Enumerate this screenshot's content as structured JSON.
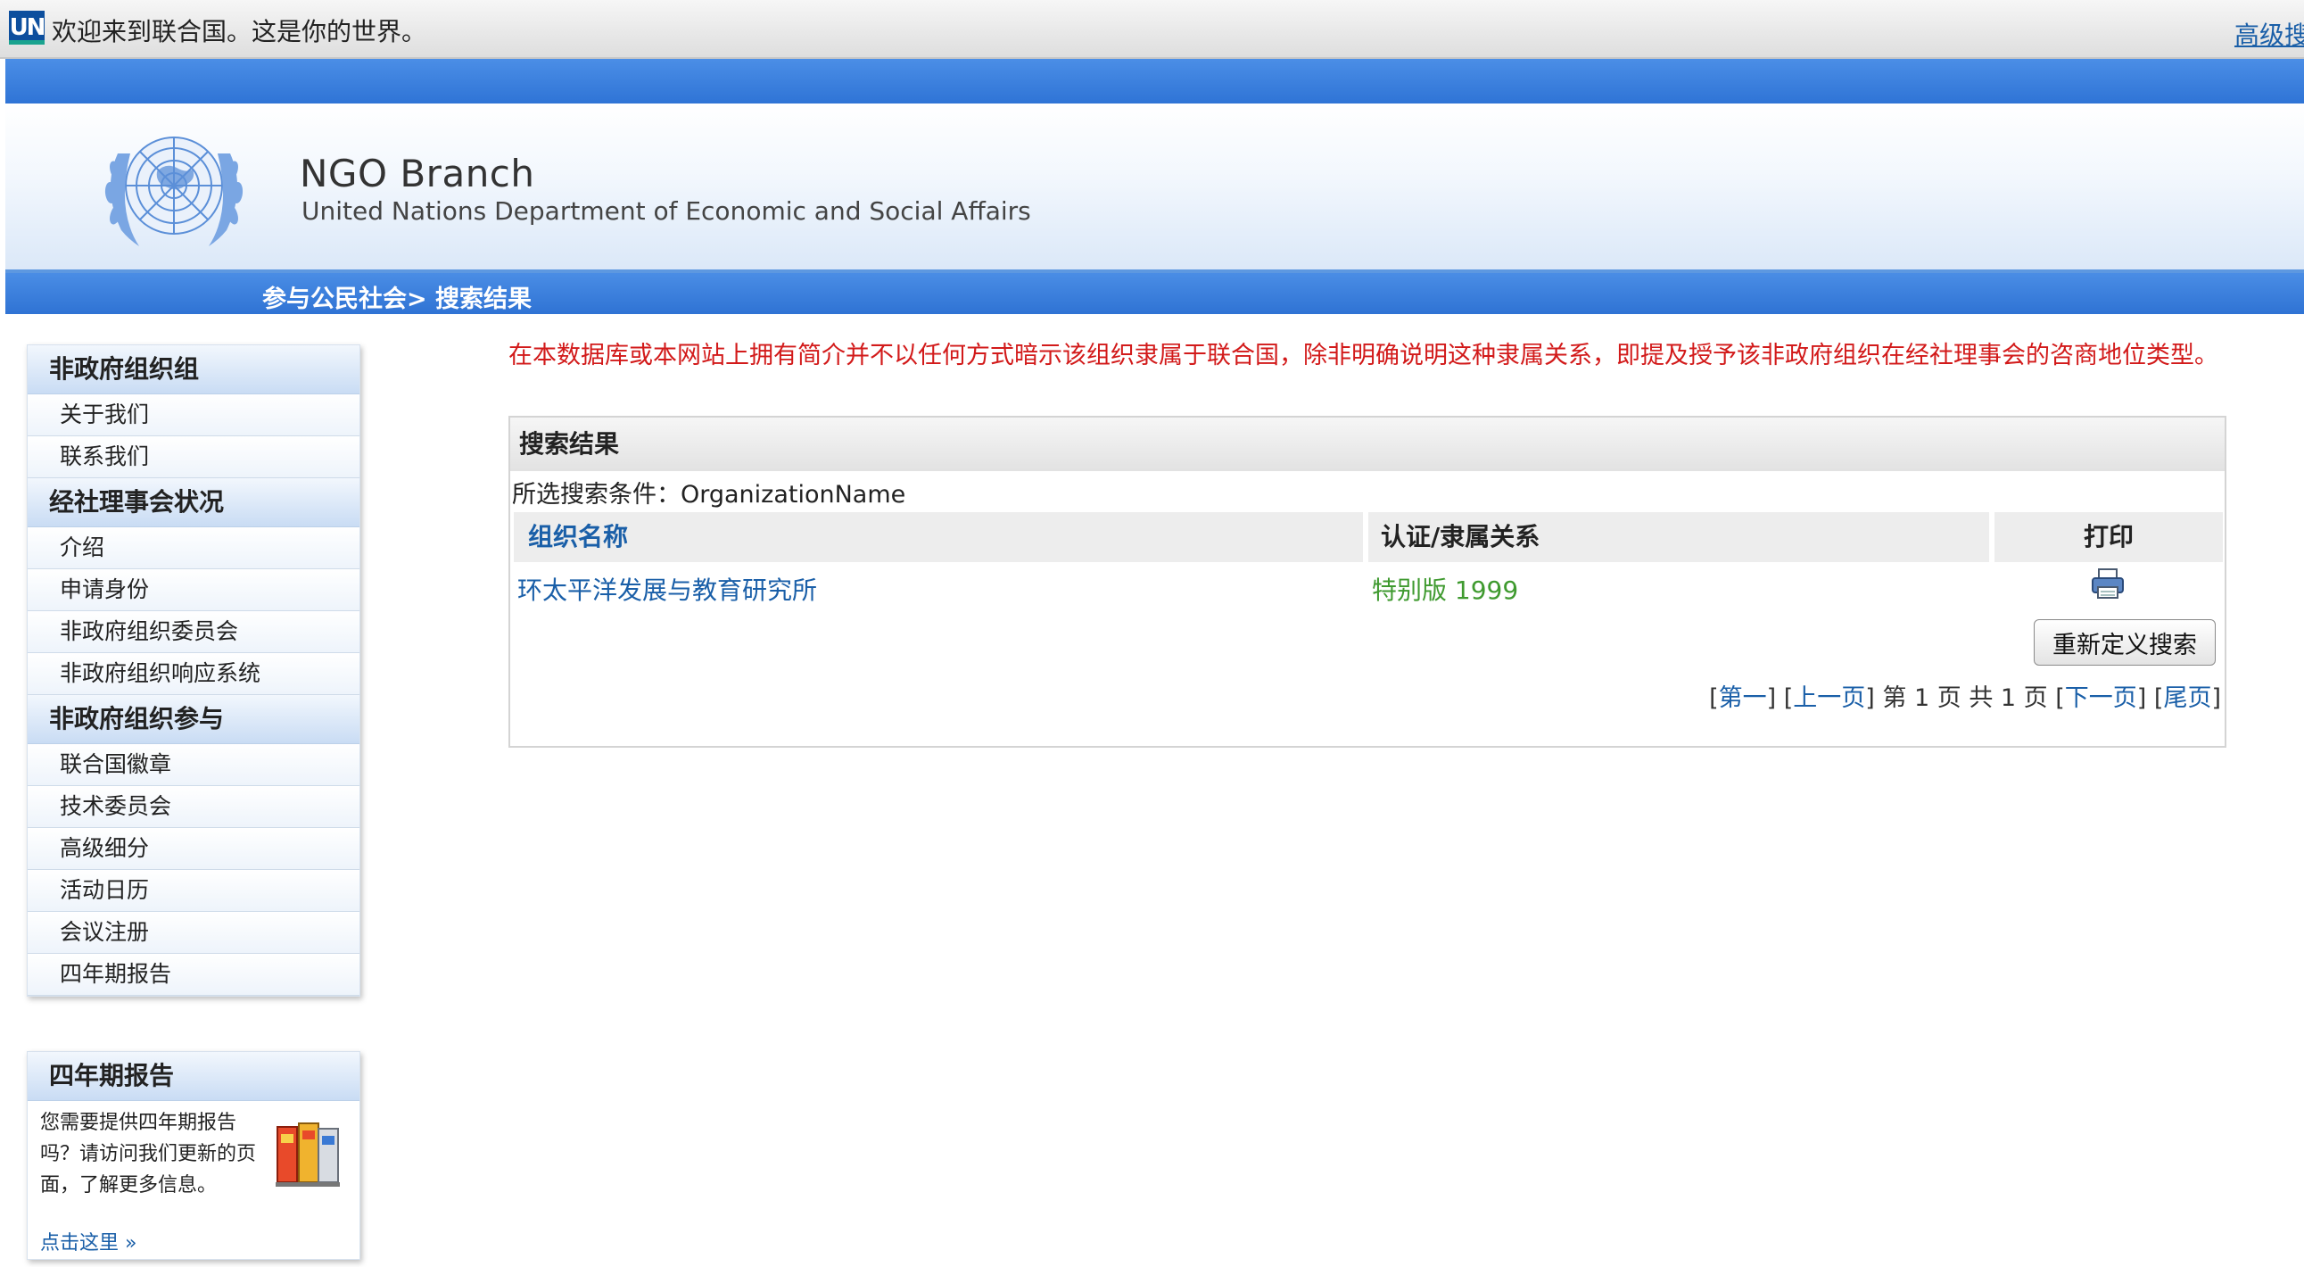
{
  "topbar": {
    "logo_text": "UN",
    "welcome": "欢迎来到联合国。这是你的世界。",
    "advanced_search": "高级搜"
  },
  "banner": {
    "title": "NGO Branch",
    "subtitle": "United Nations Department of Economic and Social Affairs",
    "emblem_icon": "un-emblem-icon"
  },
  "breadcrumb": "参与公民社会> 搜索结果",
  "sidebar": {
    "sections": [
      {
        "title": "非政府组织组",
        "items": [
          "关于我们",
          "联系我们"
        ]
      },
      {
        "title": "经社理事会状况",
        "items": [
          "介绍",
          "申请身份",
          "非政府组织委员会",
          "非政府组织响应系统"
        ]
      },
      {
        "title": "非政府组织参与",
        "items": [
          "联合国徽章",
          "技术委员会",
          "高级细分",
          "活动日历",
          "会议注册",
          "四年期报告"
        ]
      }
    ],
    "promo": {
      "title": "四年期报告",
      "text": "您需要提供四年期报告吗？请访问我们更新的页面，了解更多信息。",
      "link": "点击这里 »",
      "icon": "books-icon"
    }
  },
  "main": {
    "disclaimer": "在本数据库或本网站上拥有简介并不以任何方式暗示该组织隶属于联合国，除非明确说明这种隶属关系，即提及授予该非政府组织在经社理事会的咨商地位类型。",
    "results_title": "搜索结果",
    "criteria": "所选搜索条件：OrganizationName",
    "columns": [
      "组织名称",
      "认证/隶属关系",
      "打印"
    ],
    "rows": [
      {
        "name": "环太平洋发展与教育研究所",
        "status": "特别版 1999",
        "print_icon": "printer-icon"
      }
    ],
    "refine_button": "重新定义搜索",
    "pager": {
      "first": "第一",
      "prev": "上一页",
      "info": "第 1 页 共 1 页",
      "next": "下一页",
      "last": "尾页"
    }
  },
  "colors": {
    "accent_blue": "#2f74d6",
    "link_blue": "#1a5fa8",
    "warning_red": "#d21a1a",
    "status_green": "#3f9a2f"
  }
}
